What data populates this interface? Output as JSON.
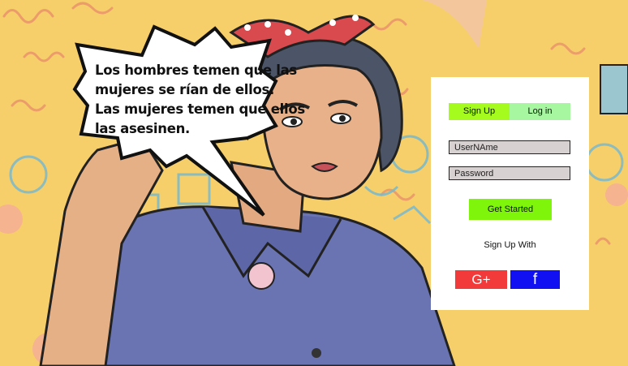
{
  "speech_bubble": {
    "lines": [
      "Los hombres temen que las",
      "mujeres se rían de ellos.",
      "Las mujeres temen que ellos",
      "las asesinen."
    ]
  },
  "auth": {
    "tabs": {
      "signup": "Sign Up",
      "login": "Log in"
    },
    "username_placeholder": "UserNAme",
    "password_placeholder": "Password",
    "get_started": "Get Started",
    "signup_with": "Sign Up With",
    "google_plus": "G+",
    "facebook": "f"
  },
  "colors": {
    "background": "#f7cf6a",
    "signup_tab": "#a5fb1d",
    "login_tab": "#a7f6a0",
    "get_started": "#80f50c",
    "google_plus": "#f33a3a",
    "facebook": "#1010f2"
  }
}
